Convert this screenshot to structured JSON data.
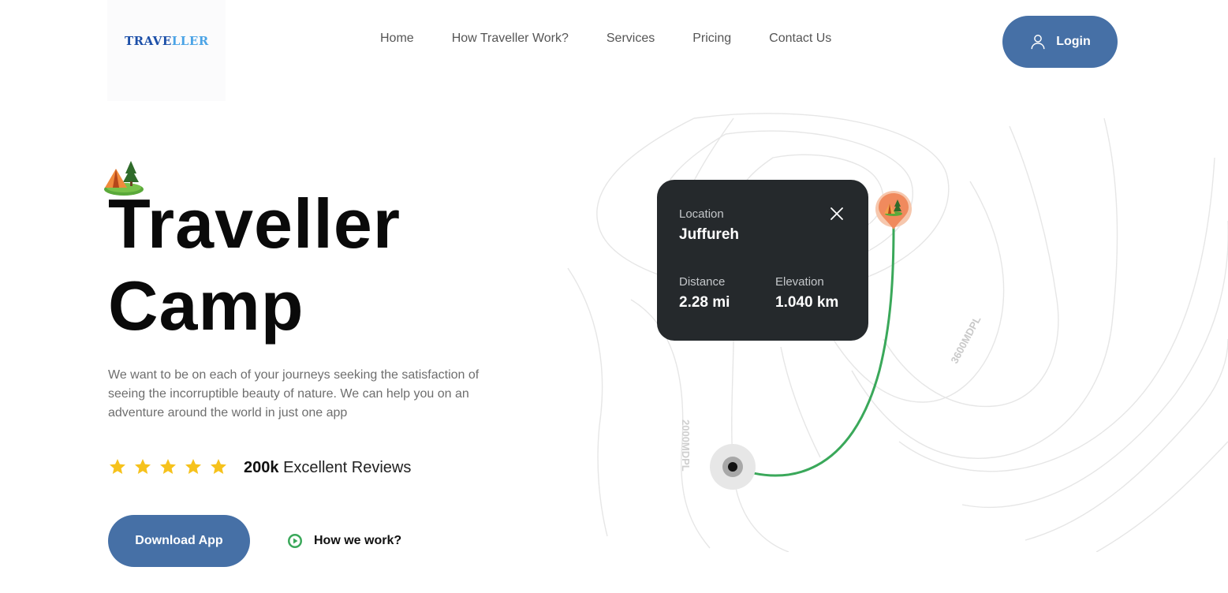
{
  "brand": {
    "logo_part1": "TRAVE",
    "logo_part2": "LLER"
  },
  "nav": {
    "items": [
      "Home",
      "How Traveller Work?",
      "Services",
      "Pricing",
      "Contact Us"
    ],
    "login_label": "Login"
  },
  "hero": {
    "title_line1": "Traveller",
    "title_line2": "Camp",
    "description": "We want to be on each of your journeys seeking the satisfaction of seeing the incorruptible beauty of nature. We can help you on an adventure around the world in just one app",
    "rating_stars": 5,
    "reviews_count": "200k",
    "reviews_label": "Excellent Reviews",
    "download_label": "Download App",
    "how_label": "How we work?"
  },
  "map": {
    "contour_label_1": "3600MDPL",
    "contour_label_2": "2000MDPL",
    "card": {
      "location_label": "Location",
      "location_value": "Juffureh",
      "distance_label": "Distance",
      "distance_value": "2.28 mi",
      "elevation_label": "Elevation",
      "elevation_value": "1.040 km"
    }
  },
  "colors": {
    "primary": "#4670a6",
    "card_bg": "#25292c",
    "route": "#3aa85a",
    "star": "#f6c21c",
    "pin": "#f08a5d"
  }
}
